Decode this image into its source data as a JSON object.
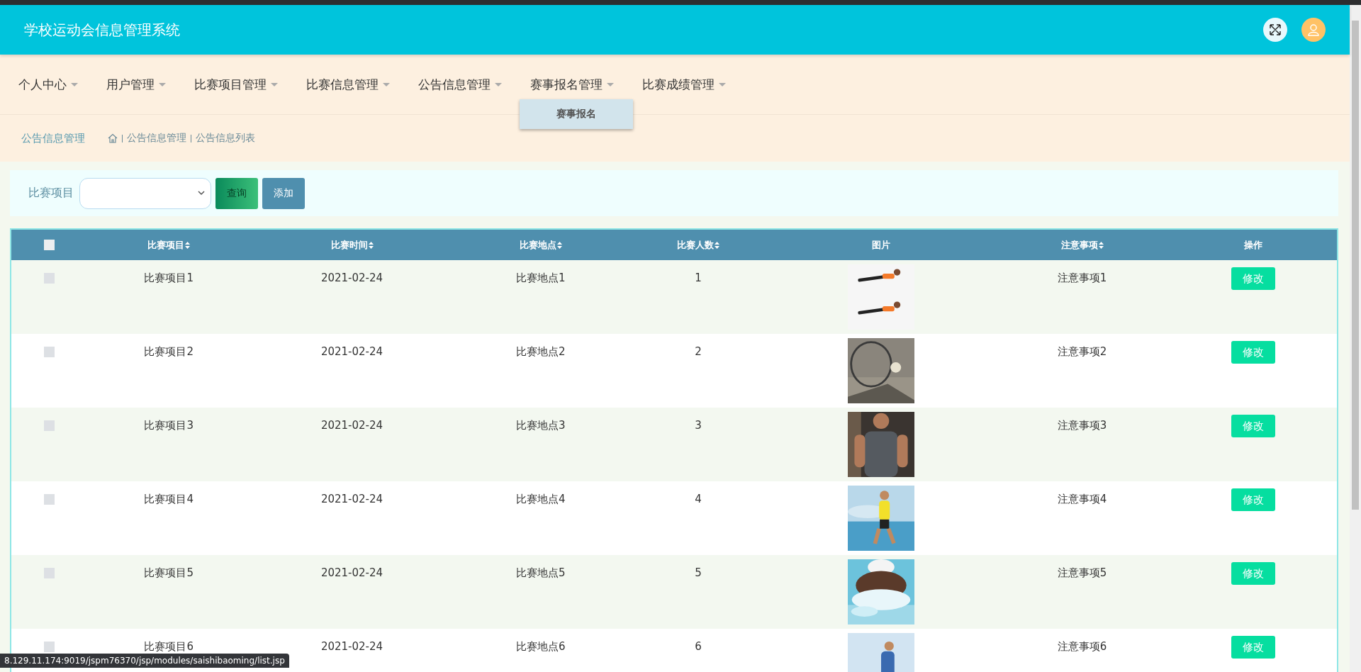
{
  "header": {
    "title": "学校运动会信息管理系统"
  },
  "nav": [
    {
      "label": "个人中心"
    },
    {
      "label": "用户管理"
    },
    {
      "label": "比赛项目管理"
    },
    {
      "label": "比赛信息管理"
    },
    {
      "label": "公告信息管理"
    },
    {
      "label": "赛事报名管理",
      "menu": [
        "赛事报名"
      ]
    },
    {
      "label": "比赛成绩管理"
    }
  ],
  "breadcrumb": {
    "title": "公告信息管理",
    "path": [
      "公告信息管理",
      "公告信息列表"
    ]
  },
  "search": {
    "label": "比赛项目",
    "buttons": [
      {
        "label": "查询",
        "kind": "query"
      },
      {
        "label": "添加",
        "kind": "add"
      }
    ]
  },
  "table": {
    "all_checked": false,
    "columns": [
      {
        "label": "比赛项目",
        "kind": "text",
        "sortable": true
      },
      {
        "label": "比赛时间",
        "kind": "text",
        "sortable": true
      },
      {
        "label": "比赛地点",
        "kind": "text",
        "sortable": true
      },
      {
        "label": "比赛人数",
        "kind": "text",
        "sortable": true
      },
      {
        "label": "图片",
        "sortable": false
      },
      {
        "label": "注意事项",
        "kind": "text",
        "sortable": true
      },
      {
        "label": "操作",
        "kind": "action",
        "sortable": false
      }
    ],
    "rows": [
      {
        "checked": false,
        "cells": [
          "比赛项目1",
          "2021-02-24",
          "比赛地点1",
          "1",
          "注意事项1"
        ],
        "image": {
          "kind": "picture"
        },
        "action": "修改"
      },
      {
        "checked": false,
        "cells": [
          "比赛项目2",
          "2021-02-24",
          "比赛地点2",
          "2",
          "注意事项2"
        ],
        "image": {
          "kind": "picture"
        },
        "action": "修改"
      },
      {
        "checked": false,
        "cells": [
          "比赛项目3",
          "2021-02-24",
          "比赛地点3",
          "3",
          "注意事项3"
        ],
        "image": {
          "kind": "picture"
        },
        "action": "修改"
      },
      {
        "checked": false,
        "cells": [
          "比赛项目4",
          "2021-02-24",
          "比赛地点4",
          "4",
          "注意事项4"
        ],
        "image": {
          "kind": "picture"
        },
        "action": "修改"
      },
      {
        "checked": false,
        "cells": [
          "比赛项目5",
          "2021-02-24",
          "比赛地点5",
          "5",
          "注意事项5"
        ],
        "image": {
          "kind": "picture"
        },
        "action": "修改"
      },
      {
        "checked": false,
        "cells": [
          "比赛项目6",
          "2021-02-24",
          "比赛地点6",
          "6",
          "注意事项6"
        ],
        "image": {
          "kind": "picture"
        },
        "action": "修改"
      }
    ]
  },
  "status_bar": {
    "url": "8.129.11.174:9019/jspm76370/jsp/modules/saishibaoming/list.jsp"
  }
}
